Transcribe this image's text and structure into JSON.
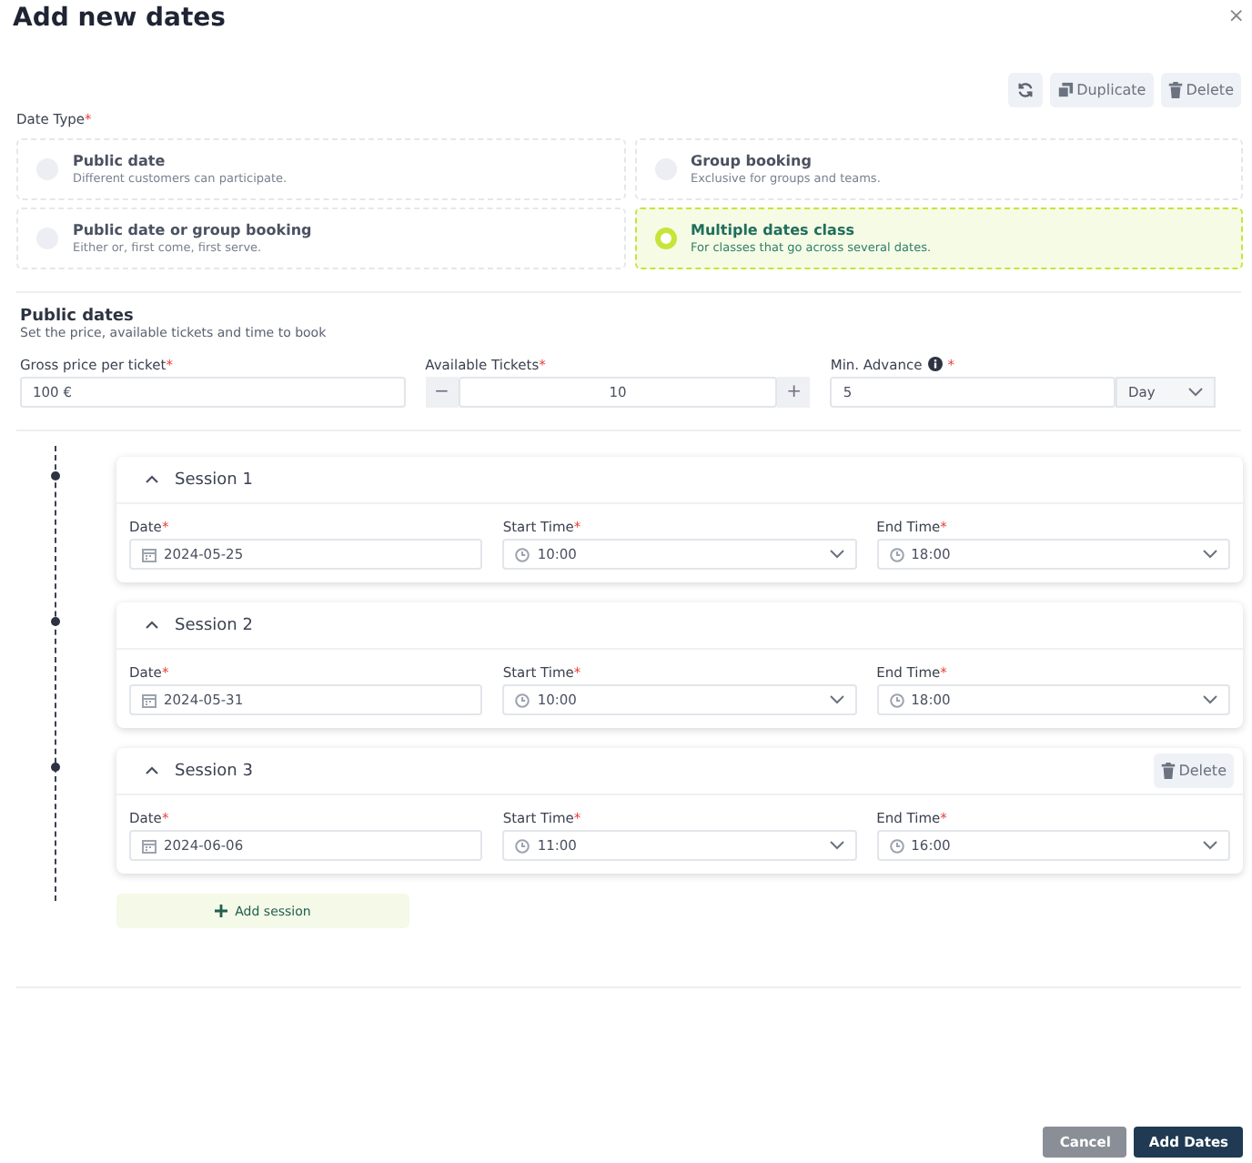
{
  "title": "Add new dates",
  "close": "×",
  "toolbar": [
    {
      "kind": "refresh"
    },
    {
      "kind": "duplicate",
      "label": "Duplicate"
    },
    {
      "kind": "delete",
      "label": "Delete"
    }
  ],
  "date_type": {
    "label": "Date Type",
    "required": "*",
    "options": [
      {
        "title": "Public date",
        "description": "Different customers can participate.",
        "selected": false
      },
      {
        "title": "Group booking",
        "description": "Exclusive for groups and teams.",
        "selected": false
      },
      {
        "title": "Public date or group booking",
        "description": "Either or, first come, first serve.",
        "selected": false
      },
      {
        "title": "Multiple dates class",
        "description": "For classes that go across several dates.",
        "selected": true
      }
    ]
  },
  "public_dates": {
    "title": "Public dates",
    "subtitle": "Set the price, available tickets and time to book",
    "price": {
      "label": "Gross price per ticket",
      "required": "*",
      "value": "100 €"
    },
    "tickets": {
      "label": "Available Tickets",
      "required": "*",
      "value": "10",
      "minus": "−",
      "plus": "+"
    },
    "advance": {
      "label": "Min. Advance",
      "required": "*",
      "info": true,
      "value": "5",
      "unit": "Day"
    }
  },
  "sessions": [
    {
      "title": "Session 1",
      "expanded": true,
      "date": {
        "label": "Date",
        "required": "*",
        "value": "2024-05-25"
      },
      "start": {
        "label": "Start Time",
        "required": "*",
        "value": "10:00"
      },
      "end": {
        "label": "End Time",
        "required": "*",
        "value": "18:00"
      }
    },
    {
      "title": "Session 2",
      "expanded": true,
      "date": {
        "label": "Date",
        "required": "*",
        "value": "2024-05-31"
      },
      "start": {
        "label": "Start Time",
        "required": "*",
        "value": "10:00"
      },
      "end": {
        "label": "End Time",
        "required": "*",
        "value": "18:00"
      }
    },
    {
      "title": "Session 3",
      "expanded": true,
      "delete": "Delete",
      "date": {
        "label": "Date",
        "required": "*",
        "value": "2024-06-06"
      },
      "start": {
        "label": "Start Time",
        "required": "*",
        "value": "11:00"
      },
      "end": {
        "label": "End Time",
        "required": "*",
        "value": "16:00"
      }
    }
  ],
  "add_session": "Add session",
  "footer": [
    {
      "kind": "secondary",
      "label": "Cancel"
    },
    {
      "kind": "primary",
      "label": "Add Dates"
    }
  ]
}
